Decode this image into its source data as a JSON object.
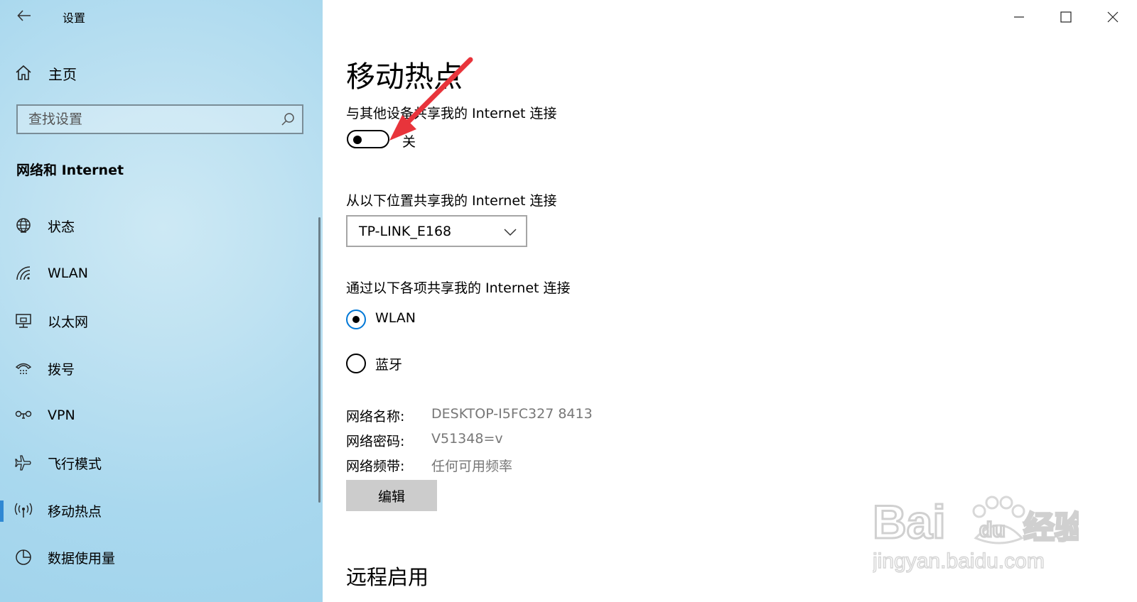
{
  "window": {
    "title": "设置"
  },
  "sidebar": {
    "home_label": "主页",
    "search_placeholder": "查找设置",
    "section_title": "网络和 Internet",
    "items": [
      {
        "label": "状态",
        "icon": "globe-icon"
      },
      {
        "label": "WLAN",
        "icon": "wifi-icon"
      },
      {
        "label": "以太网",
        "icon": "ethernet-icon"
      },
      {
        "label": "拨号",
        "icon": "dialup-icon"
      },
      {
        "label": "VPN",
        "icon": "vpn-icon"
      },
      {
        "label": "飞行模式",
        "icon": "airplane-icon"
      },
      {
        "label": "移动热点",
        "icon": "hotspot-icon",
        "selected": true
      },
      {
        "label": "数据使用量",
        "icon": "data-usage-icon"
      }
    ],
    "accent_color": "#2f88d3"
  },
  "main": {
    "title": "移动热点",
    "share_label": "与其他设备共享我的 Internet 连接",
    "toggle_state": "关",
    "share_from_label": "从以下位置共享我的 Internet 连接",
    "share_from_value": "TP-LINK_E168",
    "share_over_label": "通过以下各项共享我的 Internet 连接",
    "radio_options": [
      {
        "label": "WLAN",
        "selected": true
      },
      {
        "label": "蓝牙",
        "selected": false
      }
    ],
    "props": [
      {
        "key": "网络名称:",
        "value": "DESKTOP-I5FC327 8413"
      },
      {
        "key": "网络密码:",
        "value": "V51348=v"
      },
      {
        "key": "网络频带:",
        "value": "任何可用频率"
      }
    ],
    "edit_button": "编辑",
    "remote_section": "远程启用"
  },
  "watermark": {
    "brand": "Baidu经验",
    "url": "jingyan.baidu.com"
  }
}
